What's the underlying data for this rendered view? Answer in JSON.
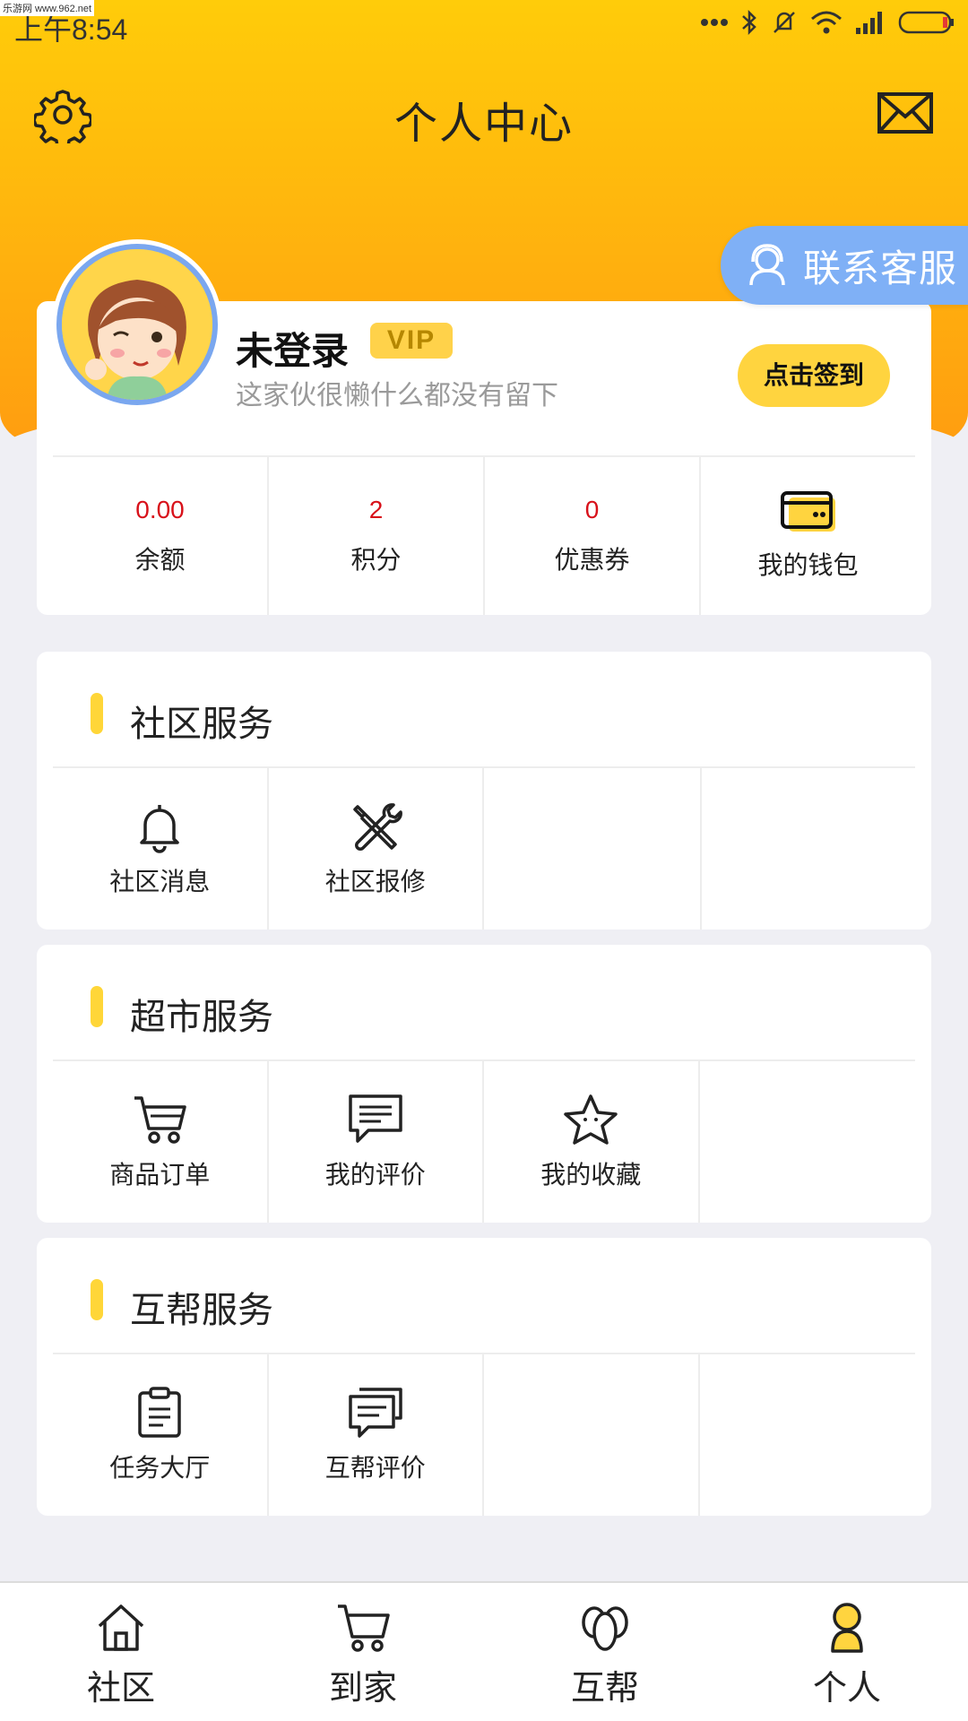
{
  "watermark": "乐游网 www.962.net",
  "status_bar": {
    "time": "上午8:54"
  },
  "header": {
    "title": "个人中心"
  },
  "customer_service": {
    "label": "联系客服"
  },
  "profile": {
    "name": "未登录",
    "badge": "VIP",
    "bio": "这家伙很懒什么都没有留下",
    "checkin_label": "点击签到",
    "stats": [
      {
        "value": "0.00",
        "label": "余额"
      },
      {
        "value": "2",
        "label": "积分"
      },
      {
        "value": "0",
        "label": "优惠券"
      }
    ],
    "wallet_label": "我的钱包"
  },
  "sections": [
    {
      "title": "社区服务",
      "items": [
        {
          "label": "社区消息",
          "icon": "bell-icon"
        },
        {
          "label": "社区报修",
          "icon": "tools-icon"
        }
      ]
    },
    {
      "title": "超市服务",
      "items": [
        {
          "label": "商品订单",
          "icon": "cart-icon"
        },
        {
          "label": "我的评价",
          "icon": "comment-icon"
        },
        {
          "label": "我的收藏",
          "icon": "star-icon"
        }
      ]
    },
    {
      "title": "互帮服务",
      "items": [
        {
          "label": "任务大厅",
          "icon": "clipboard-icon"
        },
        {
          "label": "互帮评价",
          "icon": "chat-icon"
        }
      ]
    }
  ],
  "tabs": [
    {
      "label": "社区",
      "icon": "home-icon"
    },
    {
      "label": "到家",
      "icon": "cart-icon"
    },
    {
      "label": "互帮",
      "icon": "people-icon"
    },
    {
      "label": "个人",
      "icon": "person-icon"
    }
  ],
  "colors": {
    "accent": "#ffd43f",
    "header_top": "#ffcc0a",
    "header_bottom": "#ff9d10",
    "stat_value": "#d8111a",
    "service_blue": "#7fb0f6"
  }
}
